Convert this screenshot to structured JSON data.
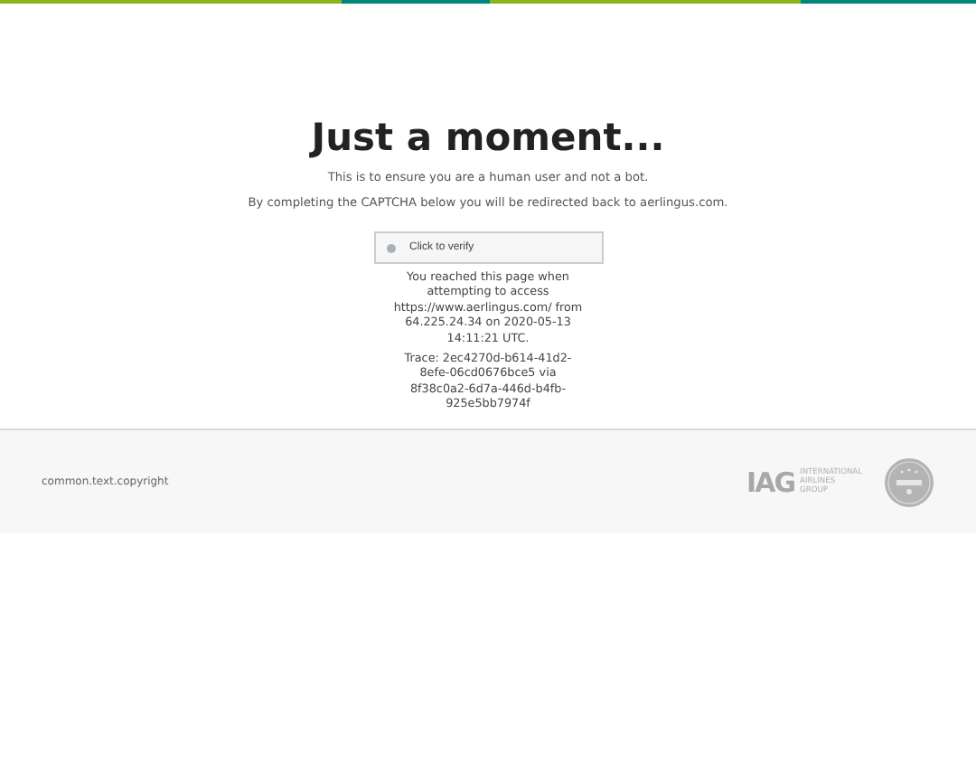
{
  "title": "Just a moment...",
  "lines": [
    "This is to ensure you are a human user and not a bot.",
    "By completing the CAPTCHA below you will be redirected back to aerlingus.com."
  ],
  "captcha": {
    "label": "Click to verify",
    "checked": false
  },
  "notice": [
    "You reached this page when attempting to access https://www.aerlingus.com/ from 64.225.24.34 on 2020-05-13 14:11:21 UTC.",
    "Trace: 2ec4270d-b614-41d2-8efe-06cd0676bce5 via 8f38c0a2-6d7a-446d-b4fb-925e5bb7974f"
  ],
  "footer": {
    "copyright": "common.text.copyright",
    "logo_mark": "IAG",
    "logo_text": [
      "INTERNATIONAL",
      "AIRLINES",
      "GROUP"
    ]
  }
}
